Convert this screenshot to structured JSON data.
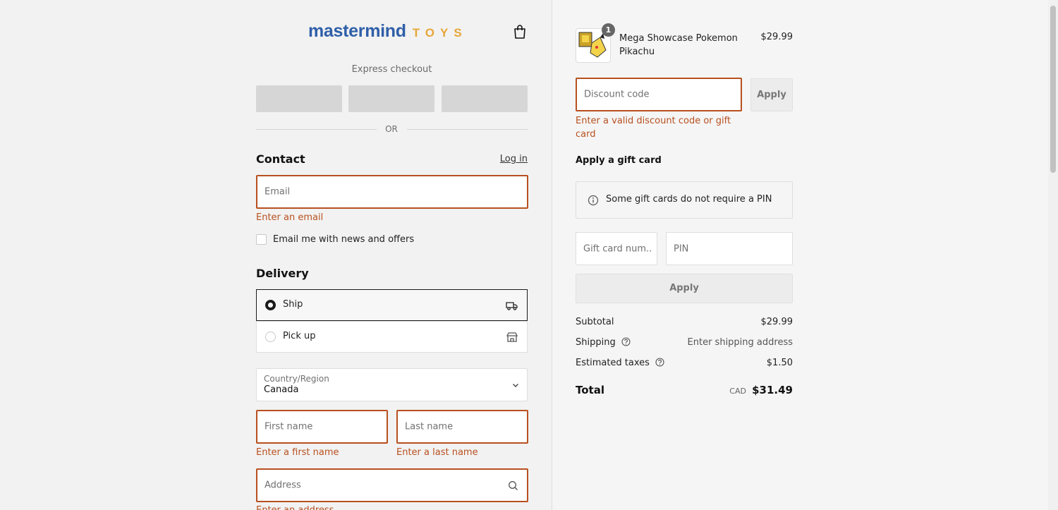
{
  "brand": {
    "name": "mastermind",
    "suffix": "TOYS"
  },
  "express": {
    "label": "Express checkout",
    "or": "OR"
  },
  "contact": {
    "heading": "Contact",
    "login": "Log in",
    "email_placeholder": "Email",
    "email_error": "Enter an email",
    "newsletter_label": "Email me with news and offers"
  },
  "delivery": {
    "heading": "Delivery",
    "options": [
      {
        "label": "Ship",
        "selected": true,
        "icon": "truck-icon"
      },
      {
        "label": "Pick up",
        "selected": false,
        "icon": "store-icon"
      }
    ],
    "country_label": "Country/Region",
    "country_value": "Canada",
    "first_name_placeholder": "First name",
    "first_name_error": "Enter a first name",
    "last_name_placeholder": "Last name",
    "last_name_error": "Enter a last name",
    "address_placeholder": "Address",
    "address_error": "Enter an address"
  },
  "summary": {
    "product": {
      "name": "Mega Showcase Pokemon Pikachu",
      "price": "$29.99",
      "quantity": "1"
    },
    "discount": {
      "placeholder": "Discount code",
      "apply": "Apply",
      "error": "Enter a valid discount code or gift card"
    },
    "gift_card": {
      "heading": "Apply a gift card",
      "info": "Some gift cards do not require a PIN",
      "number_placeholder": "Gift card num...",
      "pin_placeholder": "PIN",
      "apply": "Apply"
    },
    "subtotal_label": "Subtotal",
    "subtotal_value": "$29.99",
    "shipping_label": "Shipping",
    "shipping_value": "Enter shipping address",
    "taxes_label": "Estimated taxes",
    "taxes_value": "$1.50",
    "total_label": "Total",
    "total_currency": "CAD",
    "total_value": "$31.49"
  },
  "colors": {
    "error": "#b8501f",
    "brand_blue": "#2f5fa8",
    "brand_orange": "#e7a63a"
  }
}
